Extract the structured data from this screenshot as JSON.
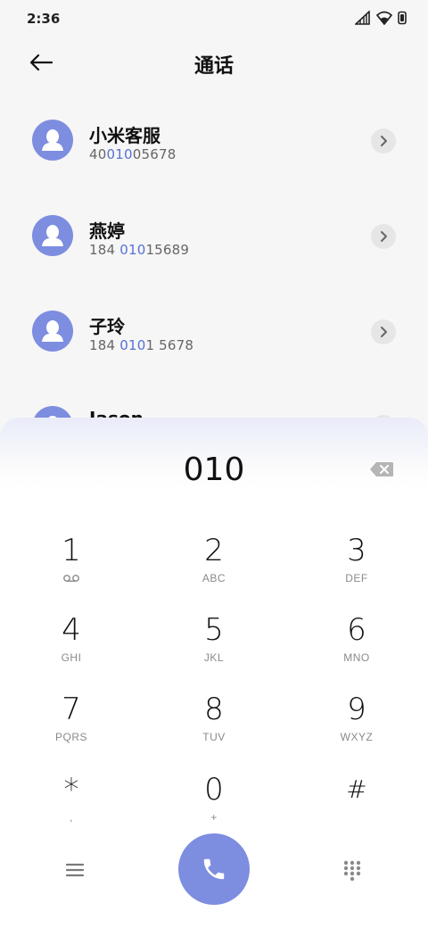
{
  "status_bar": {
    "time": "2:36"
  },
  "header": {
    "title": "通话",
    "back_icon": "arrow-left-icon"
  },
  "contacts": [
    {
      "name": "小米客服",
      "number_pre": "40",
      "number_hl": "010",
      "number_post": "05678"
    },
    {
      "name": "燕婷",
      "number_pre": "184 ",
      "number_hl": "010",
      "number_post": "15689"
    },
    {
      "name": "子玲",
      "number_pre": "184 ",
      "number_hl": "010",
      "number_post": "1 5678"
    },
    {
      "name": "Jason",
      "number_pre": "",
      "number_hl": "",
      "number_post": ""
    }
  ],
  "dialpad": {
    "input": "010",
    "keys": [
      {
        "digit": "1",
        "letters": "",
        "symbol": "voicemail-icon"
      },
      {
        "digit": "2",
        "letters": "ABC"
      },
      {
        "digit": "3",
        "letters": "DEF"
      },
      {
        "digit": "4",
        "letters": "GHI"
      },
      {
        "digit": "5",
        "letters": "JKL"
      },
      {
        "digit": "6",
        "letters": "MNO"
      },
      {
        "digit": "7",
        "letters": "PQRS"
      },
      {
        "digit": "8",
        "letters": "TUV"
      },
      {
        "digit": "9",
        "letters": "WXYZ"
      },
      {
        "digit": "*",
        "letters": ","
      },
      {
        "digit": "0",
        "letters": "+"
      },
      {
        "digit": "#",
        "letters": ""
      }
    ]
  },
  "colors": {
    "accent": "#7d8de0",
    "highlight": "#5670d8"
  }
}
